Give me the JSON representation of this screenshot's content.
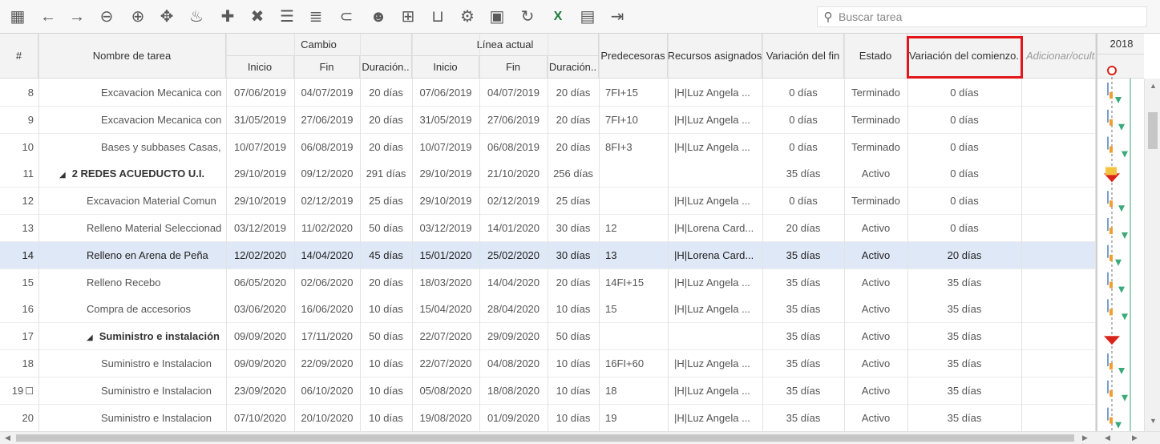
{
  "toolbar": {
    "icons": [
      {
        "name": "calendar-icon",
        "glyph": "▦"
      },
      {
        "name": "arrow-left-icon",
        "glyph": "←"
      },
      {
        "name": "arrow-right-icon",
        "glyph": "→"
      },
      {
        "name": "zoom-out-icon",
        "glyph": "⊖"
      },
      {
        "name": "zoom-in-icon",
        "glyph": "⊕"
      },
      {
        "name": "move-icon",
        "glyph": "✥"
      },
      {
        "name": "flame-icon",
        "glyph": "♨"
      },
      {
        "name": "add-icon",
        "glyph": "✚"
      },
      {
        "name": "delete-icon",
        "glyph": "✖"
      },
      {
        "name": "indent-icon",
        "glyph": "☰"
      },
      {
        "name": "outdent-icon",
        "glyph": "≣"
      },
      {
        "name": "link-icon",
        "glyph": "⊂"
      },
      {
        "name": "resource-icon",
        "glyph": "☻"
      },
      {
        "name": "hierarchy-icon",
        "glyph": "⊞"
      },
      {
        "name": "cart-icon",
        "glyph": "⊔"
      },
      {
        "name": "settings-gear-icon",
        "glyph": "⚙"
      },
      {
        "name": "save-icon",
        "glyph": "▣"
      },
      {
        "name": "refresh-icon",
        "glyph": "↻"
      },
      {
        "name": "excel-export-icon",
        "glyph": "X"
      },
      {
        "name": "report-icon",
        "glyph": "▤"
      },
      {
        "name": "exit-icon",
        "glyph": "⇥"
      }
    ]
  },
  "search": {
    "placeholder": "Buscar tarea"
  },
  "header": {
    "num": "#",
    "task_name": "Nombre de tarea",
    "group_cambio": "Cambio",
    "group_linea": "Línea actual",
    "inicio": "Inicio",
    "fin": "Fin",
    "duracion": "Duración..",
    "inicio2": "Inicio",
    "fin2": "Fin",
    "duracion2": "Duración..",
    "predecesoras": "Predecesoras",
    "recursos": "Recursos asignados",
    "var_fin": "Variación del fin",
    "estado": "Estado",
    "var_comienzo": "Variación del comienzo.",
    "adicionar": "Adicionar/ocultar columnas",
    "year": "2018"
  },
  "rows": [
    {
      "num": "8",
      "indent": 2,
      "name": "Excavacion Mecanica con",
      "inicio": "07/06/2019",
      "fin": "04/07/2019",
      "dur": "20 días",
      "inicio2": "07/06/2019",
      "fin2": "04/07/2019",
      "dur2": "20 días",
      "pred": "7FI+15",
      "rec": "|H|Luz Angela ...",
      "vfin": "0 días",
      "estado": "Terminado",
      "vcom": "0 días"
    },
    {
      "num": "9",
      "indent": 2,
      "name": "Excavacion Mecanica con",
      "inicio": "31/05/2019",
      "fin": "27/06/2019",
      "dur": "20 días",
      "inicio2": "31/05/2019",
      "fin2": "27/06/2019",
      "dur2": "20 días",
      "pred": "7FI+10",
      "rec": "|H|Luz Angela ...",
      "vfin": "0 días",
      "estado": "Terminado",
      "vcom": "0 días"
    },
    {
      "num": "10",
      "indent": 2,
      "name": "Bases y subbases Casas,",
      "inicio": "10/07/2019",
      "fin": "06/08/2019",
      "dur": "20 días",
      "inicio2": "10/07/2019",
      "fin2": "06/08/2019",
      "dur2": "20 días",
      "pred": "8FI+3",
      "rec": "|H|Luz Angela ...",
      "vfin": "0 días",
      "estado": "Terminado",
      "vcom": "0 días"
    },
    {
      "num": "11",
      "indent": 0,
      "summary": true,
      "name": "2 REDES ACUEDUCTO U.I.",
      "inicio": "29/10/2019",
      "fin": "09/12/2020",
      "dur": "291 días",
      "inicio2": "29/10/2019",
      "fin2": "21/10/2020",
      "dur2": "256 días",
      "pred": "",
      "rec": "",
      "vfin": "35 días",
      "estado": "Activo",
      "vcom": "0 días"
    },
    {
      "num": "12",
      "indent": 1,
      "name": "Excavacion Material Comun",
      "inicio": "29/10/2019",
      "fin": "02/12/2019",
      "dur": "25 días",
      "inicio2": "29/10/2019",
      "fin2": "02/12/2019",
      "dur2": "25 días",
      "pred": "",
      "rec": "|H|Luz Angela ...",
      "vfin": "0 días",
      "estado": "Terminado",
      "vcom": "0 días"
    },
    {
      "num": "13",
      "indent": 1,
      "name": "Relleno Material Seleccionad",
      "inicio": "03/12/2019",
      "fin": "11/02/2020",
      "dur": "50 días",
      "inicio2": "03/12/2019",
      "fin2": "14/01/2020",
      "dur2": "30 días",
      "pred": "12",
      "rec": "|H|Lorena Card...",
      "vfin": "20 días",
      "estado": "Activo",
      "vcom": "0 días"
    },
    {
      "num": "14",
      "indent": 1,
      "selected": true,
      "name": "Relleno en Arena de Peña",
      "inicio": "12/02/2020",
      "fin": "14/04/2020",
      "dur": "45 días",
      "inicio2": "15/01/2020",
      "fin2": "25/02/2020",
      "dur2": "30 días",
      "pred": "13",
      "rec": "|H|Lorena Card...",
      "vfin": "35 días",
      "estado": "Activo",
      "vcom": "20 días"
    },
    {
      "num": "15",
      "indent": 1,
      "name": "Relleno Recebo",
      "inicio": "06/05/2020",
      "fin": "02/06/2020",
      "dur": "20 días",
      "inicio2": "18/03/2020",
      "fin2": "14/04/2020",
      "dur2": "20 días",
      "pred": "14FI+15",
      "rec": "|H|Luz Angela ...",
      "vfin": "35 días",
      "estado": "Activo",
      "vcom": "35 días"
    },
    {
      "num": "16",
      "indent": 1,
      "name": "Compra de accesorios",
      "inicio": "03/06/2020",
      "fin": "16/06/2020",
      "dur": "10 días",
      "inicio2": "15/04/2020",
      "fin2": "28/04/2020",
      "dur2": "10 días",
      "pred": "15",
      "rec": "|H|Luz Angela ...",
      "vfin": "35 días",
      "estado": "Activo",
      "vcom": "35 días"
    },
    {
      "num": "17",
      "indent": 1,
      "summary": true,
      "name": "Suministro e instalación",
      "inicio": "09/09/2020",
      "fin": "17/11/2020",
      "dur": "50 días",
      "inicio2": "22/07/2020",
      "fin2": "29/09/2020",
      "dur2": "50 días",
      "pred": "",
      "rec": "",
      "vfin": "35 días",
      "estado": "Activo",
      "vcom": "35 días"
    },
    {
      "num": "18",
      "indent": 2,
      "name": "Suministro e Instalacion",
      "inicio": "09/09/2020",
      "fin": "22/09/2020",
      "dur": "10 días",
      "inicio2": "22/07/2020",
      "fin2": "04/08/2020",
      "dur2": "10 días",
      "pred": "16FI+60",
      "rec": "|H|Luz Angela ...",
      "vfin": "35 días",
      "estado": "Activo",
      "vcom": "35 días"
    },
    {
      "num": "19",
      "indent": 2,
      "comment": true,
      "name": "Suministro e Instalacion",
      "inicio": "23/09/2020",
      "fin": "06/10/2020",
      "dur": "10 días",
      "inicio2": "05/08/2020",
      "fin2": "18/08/2020",
      "dur2": "10 días",
      "pred": "18",
      "rec": "|H|Luz Angela ...",
      "vfin": "35 días",
      "estado": "Activo",
      "vcom": "35 días"
    },
    {
      "num": "20",
      "indent": 2,
      "name": "Suministro e Instalacion",
      "inicio": "07/10/2020",
      "fin": "20/10/2020",
      "dur": "10 días",
      "inicio2": "19/08/2020",
      "fin2": "01/09/2020",
      "dur2": "10 días",
      "pred": "19",
      "rec": "|H|Luz Angela ...",
      "vfin": "35 días",
      "estado": "Activo",
      "vcom": "35 días"
    }
  ],
  "colors": {
    "selected_row": "#dfe8f6",
    "highlight": "#e0161b",
    "gantt_green": "#3aaa7a",
    "gantt_orange": "#f0a030",
    "gantt_red": "#d9241c"
  }
}
